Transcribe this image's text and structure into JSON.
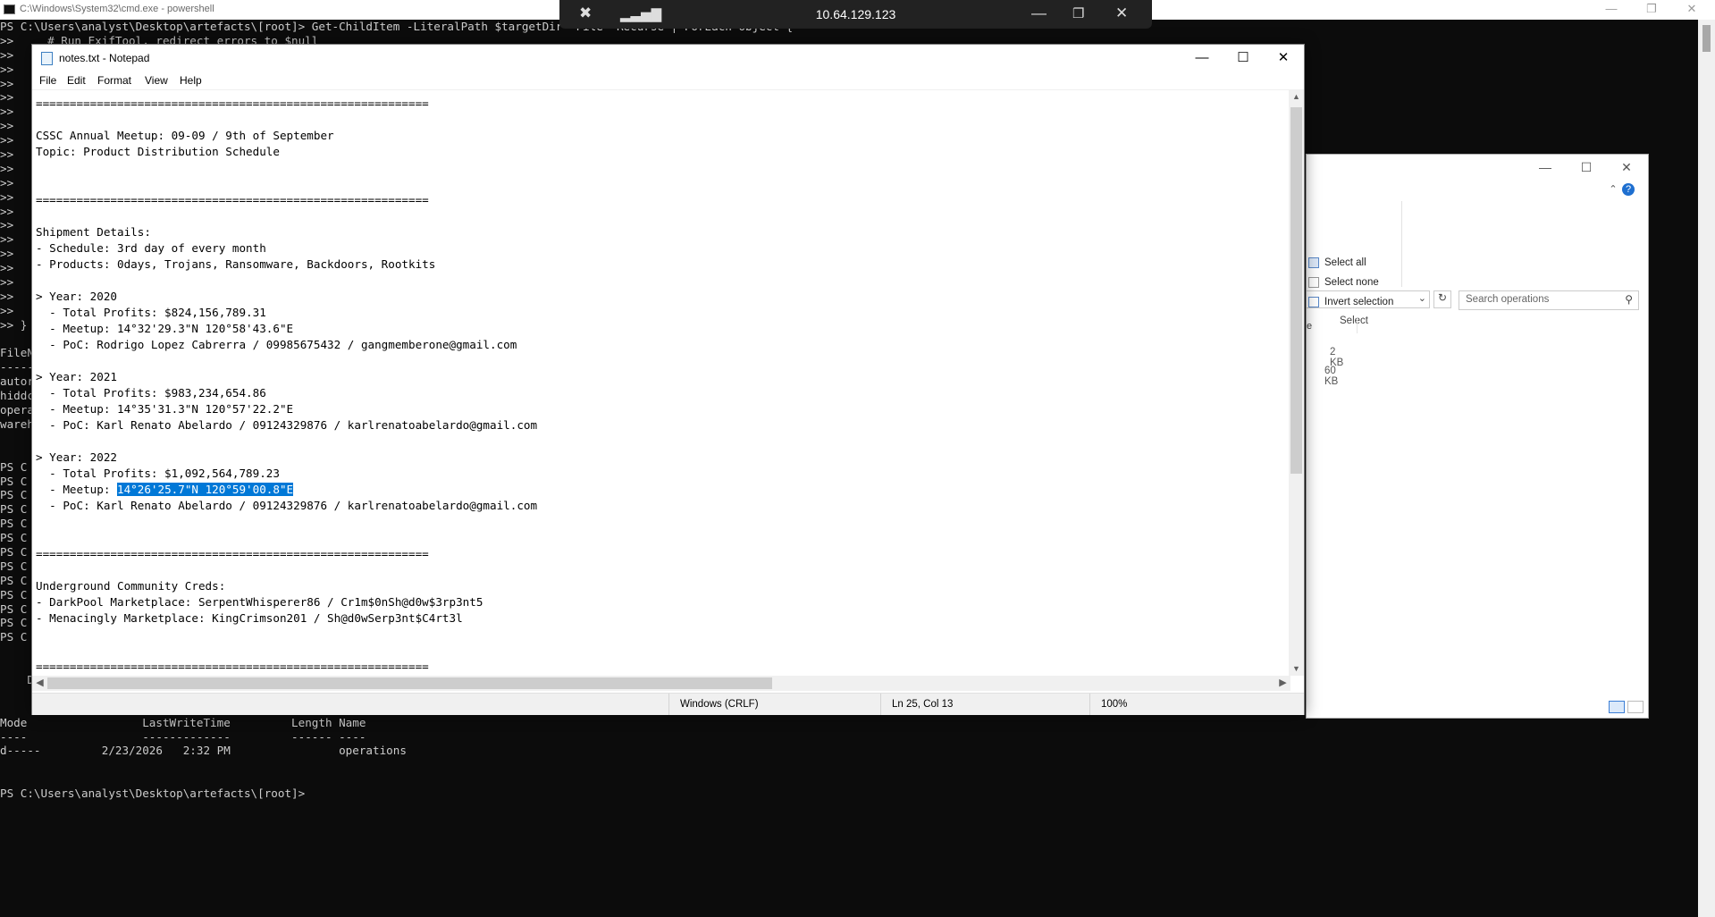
{
  "console": {
    "title": "C:\\Windows\\System32\\cmd.exe - powershell",
    "lines": [
      "PS C:\\Users\\analyst\\Desktop\\artefacts\\[root]> Get-ChildItem -LiteralPath $targetDir -File -Recurse | ForEach-Object {",
      ">>     # Run ExifTool, redirect errors to $null",
      ">>",
      ">>",
      ">>",
      ">>",
      ">>",
      ">>",
      ">>",
      ">>",
      ">>",
      ">>",
      ">>",
      ">>",
      ">>",
      ">>",
      ">>",
      ">>",
      ">>",
      ">>",
      ">>",
      ">> }",
      "",
      "FileN",
      "-----",
      "autor",
      "hiddc",
      "opera",
      "wareh",
      "",
      "",
      "PS C",
      "PS C",
      "PS C",
      "PS C",
      "PS C",
      "PS C",
      "PS C",
      "PS C",
      "PS C",
      "PS C",
      "PS C",
      "PS C",
      "PS C",
      "",
      "",
      "    D",
      "",
      "",
      "Mode                 LastWriteTime         Length Name",
      "----                 -------------         ------ ----",
      "d-----         2/23/2026   2:32 PM                operations",
      "",
      "",
      "PS C:\\Users\\analyst\\Desktop\\artefacts\\[root]>"
    ]
  },
  "rdp_bar": {
    "host": "10.64.129.123"
  },
  "explorer": {
    "ribbon": {
      "select_all": "Select all",
      "select_none": "Select none",
      "invert_selection": "Invert selection",
      "group_label": "Select"
    },
    "search_placeholder": "Search operations",
    "column_fragment": "e",
    "sizes": [
      "2 KB",
      "60 KB"
    ]
  },
  "notepad": {
    "title": "notes.txt - Notepad",
    "menu": [
      "File",
      "Edit",
      "Format",
      "View",
      "Help"
    ],
    "lines": [
      "==========================================================",
      "",
      "CSSC Annual Meetup: 09-09 / 9th of September",
      "Topic: Product Distribution Schedule",
      "",
      "",
      "==========================================================",
      "",
      "Shipment Details:",
      "- Schedule: 3rd day of every month",
      "- Products: 0days, Trojans, Ransomware, Backdoors, Rootkits",
      "",
      "> Year: 2020",
      "  - Total Profits: $824,156,789.31",
      "  - Meetup: 14°32'29.3\"N 120°58'43.6\"E",
      "  - PoC: Rodrigo Lopez Cabrerra / 09985675432 / gangmemberone@gmail.com",
      "",
      "> Year: 2021",
      "  - Total Profits: $983,234,654.86",
      "  - Meetup: 14°35'31.3\"N 120°57'22.2\"E",
      "  - PoC: Karl Renato Abelardo / 09124329876 / karlrenatoabelardo@gmail.com",
      "",
      "> Year: 2022",
      "  - Total Profits: $1,092,564,789.23",
      "",
      "  - PoC: Karl Renato Abelardo / 09124329876 / karlrenatoabelardo@gmail.com",
      "",
      "",
      "==========================================================",
      "",
      "Underground Community Creds:",
      "- DarkPool Marketplace: SerpentWhisperer86 / Cr1m$0nSh@d0w$3rp3nt5",
      "- Menacingly Marketplace: KingCrimson201 / Sh@d0wSerp3nt$C4rt3l",
      "",
      "",
      "=========================================================="
    ],
    "selected_line": {
      "prefix": "  - Meetup: ",
      "selection": "14°26'25.7\"N 120°59'00.8\"E"
    },
    "status": {
      "line_endings": "Windows (CRLF)",
      "cursor": "Ln 25, Col 13",
      "zoom": "100%"
    }
  }
}
